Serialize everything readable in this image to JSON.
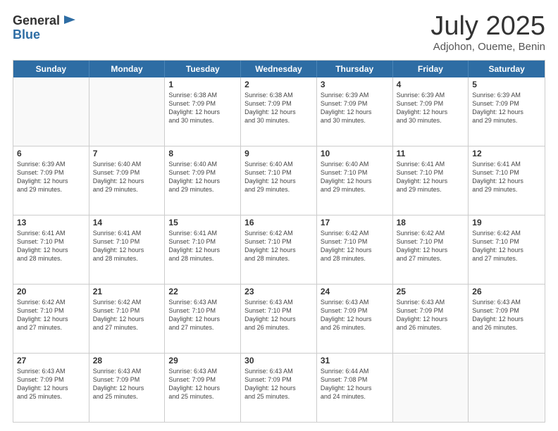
{
  "header": {
    "logo_general": "General",
    "logo_blue": "Blue",
    "month": "July 2025",
    "location": "Adjohon, Oueme, Benin"
  },
  "weekdays": [
    "Sunday",
    "Monday",
    "Tuesday",
    "Wednesday",
    "Thursday",
    "Friday",
    "Saturday"
  ],
  "rows": [
    [
      {
        "day": "",
        "lines": []
      },
      {
        "day": "",
        "lines": []
      },
      {
        "day": "1",
        "lines": [
          "Sunrise: 6:38 AM",
          "Sunset: 7:09 PM",
          "Daylight: 12 hours",
          "and 30 minutes."
        ]
      },
      {
        "day": "2",
        "lines": [
          "Sunrise: 6:38 AM",
          "Sunset: 7:09 PM",
          "Daylight: 12 hours",
          "and 30 minutes."
        ]
      },
      {
        "day": "3",
        "lines": [
          "Sunrise: 6:39 AM",
          "Sunset: 7:09 PM",
          "Daylight: 12 hours",
          "and 30 minutes."
        ]
      },
      {
        "day": "4",
        "lines": [
          "Sunrise: 6:39 AM",
          "Sunset: 7:09 PM",
          "Daylight: 12 hours",
          "and 30 minutes."
        ]
      },
      {
        "day": "5",
        "lines": [
          "Sunrise: 6:39 AM",
          "Sunset: 7:09 PM",
          "Daylight: 12 hours",
          "and 29 minutes."
        ]
      }
    ],
    [
      {
        "day": "6",
        "lines": [
          "Sunrise: 6:39 AM",
          "Sunset: 7:09 PM",
          "Daylight: 12 hours",
          "and 29 minutes."
        ]
      },
      {
        "day": "7",
        "lines": [
          "Sunrise: 6:40 AM",
          "Sunset: 7:09 PM",
          "Daylight: 12 hours",
          "and 29 minutes."
        ]
      },
      {
        "day": "8",
        "lines": [
          "Sunrise: 6:40 AM",
          "Sunset: 7:09 PM",
          "Daylight: 12 hours",
          "and 29 minutes."
        ]
      },
      {
        "day": "9",
        "lines": [
          "Sunrise: 6:40 AM",
          "Sunset: 7:10 PM",
          "Daylight: 12 hours",
          "and 29 minutes."
        ]
      },
      {
        "day": "10",
        "lines": [
          "Sunrise: 6:40 AM",
          "Sunset: 7:10 PM",
          "Daylight: 12 hours",
          "and 29 minutes."
        ]
      },
      {
        "day": "11",
        "lines": [
          "Sunrise: 6:41 AM",
          "Sunset: 7:10 PM",
          "Daylight: 12 hours",
          "and 29 minutes."
        ]
      },
      {
        "day": "12",
        "lines": [
          "Sunrise: 6:41 AM",
          "Sunset: 7:10 PM",
          "Daylight: 12 hours",
          "and 29 minutes."
        ]
      }
    ],
    [
      {
        "day": "13",
        "lines": [
          "Sunrise: 6:41 AM",
          "Sunset: 7:10 PM",
          "Daylight: 12 hours",
          "and 28 minutes."
        ]
      },
      {
        "day": "14",
        "lines": [
          "Sunrise: 6:41 AM",
          "Sunset: 7:10 PM",
          "Daylight: 12 hours",
          "and 28 minutes."
        ]
      },
      {
        "day": "15",
        "lines": [
          "Sunrise: 6:41 AM",
          "Sunset: 7:10 PM",
          "Daylight: 12 hours",
          "and 28 minutes."
        ]
      },
      {
        "day": "16",
        "lines": [
          "Sunrise: 6:42 AM",
          "Sunset: 7:10 PM",
          "Daylight: 12 hours",
          "and 28 minutes."
        ]
      },
      {
        "day": "17",
        "lines": [
          "Sunrise: 6:42 AM",
          "Sunset: 7:10 PM",
          "Daylight: 12 hours",
          "and 28 minutes."
        ]
      },
      {
        "day": "18",
        "lines": [
          "Sunrise: 6:42 AM",
          "Sunset: 7:10 PM",
          "Daylight: 12 hours",
          "and 27 minutes."
        ]
      },
      {
        "day": "19",
        "lines": [
          "Sunrise: 6:42 AM",
          "Sunset: 7:10 PM",
          "Daylight: 12 hours",
          "and 27 minutes."
        ]
      }
    ],
    [
      {
        "day": "20",
        "lines": [
          "Sunrise: 6:42 AM",
          "Sunset: 7:10 PM",
          "Daylight: 12 hours",
          "and 27 minutes."
        ]
      },
      {
        "day": "21",
        "lines": [
          "Sunrise: 6:42 AM",
          "Sunset: 7:10 PM",
          "Daylight: 12 hours",
          "and 27 minutes."
        ]
      },
      {
        "day": "22",
        "lines": [
          "Sunrise: 6:43 AM",
          "Sunset: 7:10 PM",
          "Daylight: 12 hours",
          "and 27 minutes."
        ]
      },
      {
        "day": "23",
        "lines": [
          "Sunrise: 6:43 AM",
          "Sunset: 7:10 PM",
          "Daylight: 12 hours",
          "and 26 minutes."
        ]
      },
      {
        "day": "24",
        "lines": [
          "Sunrise: 6:43 AM",
          "Sunset: 7:09 PM",
          "Daylight: 12 hours",
          "and 26 minutes."
        ]
      },
      {
        "day": "25",
        "lines": [
          "Sunrise: 6:43 AM",
          "Sunset: 7:09 PM",
          "Daylight: 12 hours",
          "and 26 minutes."
        ]
      },
      {
        "day": "26",
        "lines": [
          "Sunrise: 6:43 AM",
          "Sunset: 7:09 PM",
          "Daylight: 12 hours",
          "and 26 minutes."
        ]
      }
    ],
    [
      {
        "day": "27",
        "lines": [
          "Sunrise: 6:43 AM",
          "Sunset: 7:09 PM",
          "Daylight: 12 hours",
          "and 25 minutes."
        ]
      },
      {
        "day": "28",
        "lines": [
          "Sunrise: 6:43 AM",
          "Sunset: 7:09 PM",
          "Daylight: 12 hours",
          "and 25 minutes."
        ]
      },
      {
        "day": "29",
        "lines": [
          "Sunrise: 6:43 AM",
          "Sunset: 7:09 PM",
          "Daylight: 12 hours",
          "and 25 minutes."
        ]
      },
      {
        "day": "30",
        "lines": [
          "Sunrise: 6:43 AM",
          "Sunset: 7:09 PM",
          "Daylight: 12 hours",
          "and 25 minutes."
        ]
      },
      {
        "day": "31",
        "lines": [
          "Sunrise: 6:44 AM",
          "Sunset: 7:08 PM",
          "Daylight: 12 hours",
          "and 24 minutes."
        ]
      },
      {
        "day": "",
        "lines": []
      },
      {
        "day": "",
        "lines": []
      }
    ]
  ]
}
